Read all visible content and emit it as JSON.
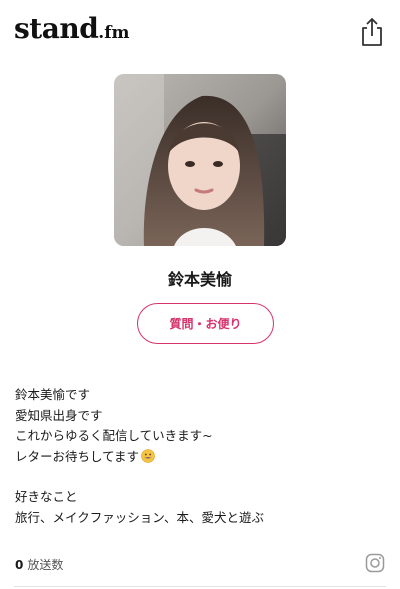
{
  "header": {
    "logo_main": "stand",
    "logo_suffix": ".fm",
    "share_icon": "share-icon"
  },
  "profile": {
    "name": "鈴本美愉",
    "letter_button_label": "質問・お便り"
  },
  "bio": {
    "lines": [
      "鈴本美愉です",
      "愛知県出身です",
      "これからゆるく配信していきます~",
      "レターお待ちしてます"
    ],
    "emoji_icon": "grinning-face-icon",
    "likes_heading": "好きなこと",
    "likes": "旅行、メイクファッション、本、愛犬と遊ぶ"
  },
  "stats": {
    "broadcast_count": "0",
    "broadcast_label": "放送数"
  },
  "social": {
    "instagram_icon": "instagram-icon"
  },
  "colors": {
    "accent": "#d6336c",
    "text": "#1a1a1a",
    "muted": "#555555"
  }
}
